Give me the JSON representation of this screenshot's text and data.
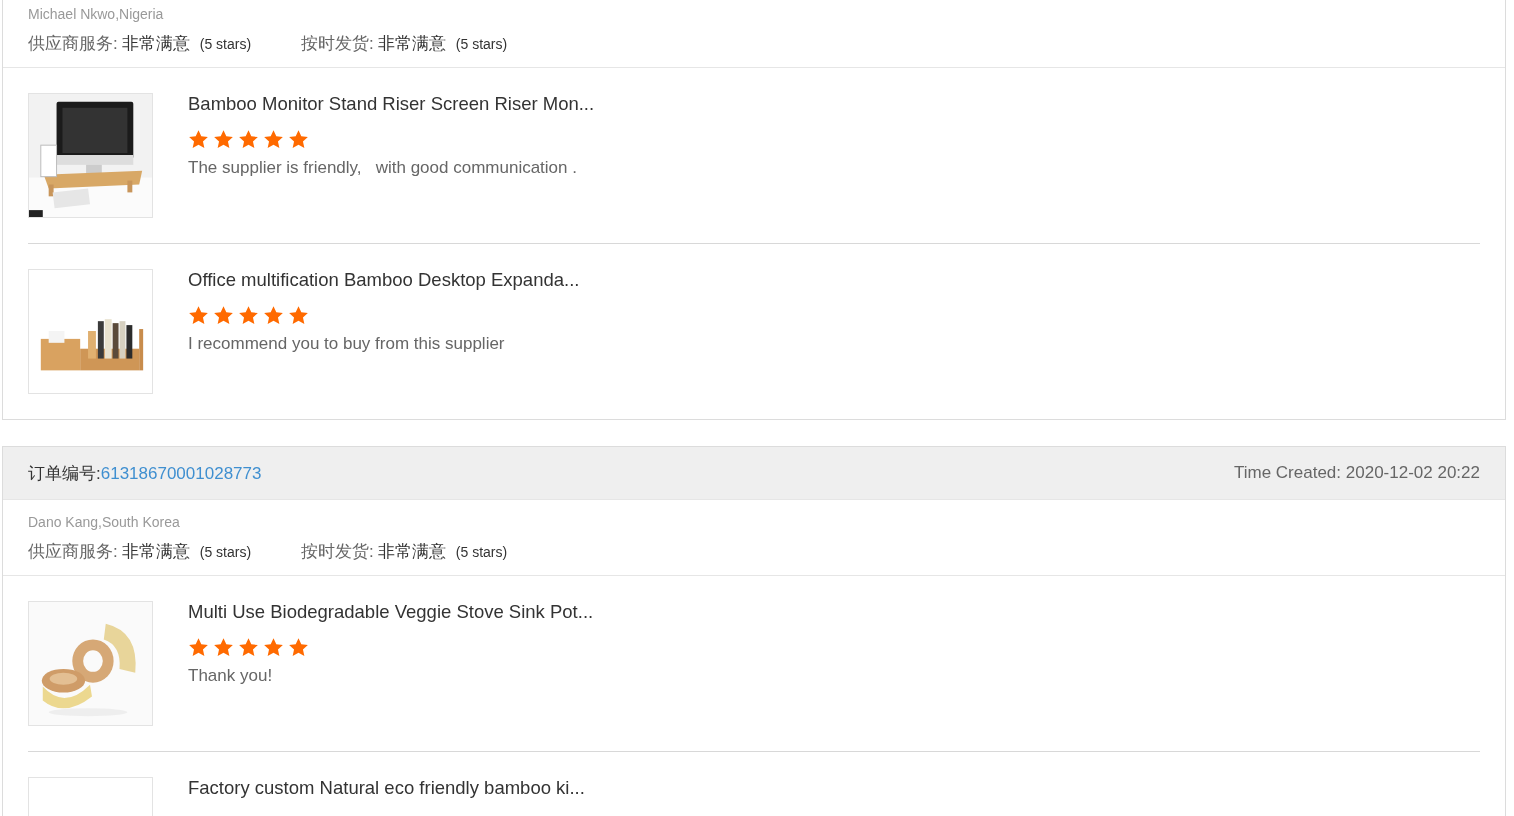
{
  "orders": [
    {
      "buyer": "Michael Nkwo,Nigeria",
      "ratings": [
        {
          "label": "供应商服务:",
          "value": "非常满意",
          "stars_text": "(5 stars)"
        },
        {
          "label": "按时发货:",
          "value": "非常满意",
          "stars_text": "(5 stars)"
        }
      ],
      "products": [
        {
          "title": "Bamboo Monitor Stand Riser Screen Riser Mon...",
          "stars": 5,
          "comment": "The supplier is friendly,   with good communication .",
          "kind": "picture"
        },
        {
          "title": "Office multification Bamboo Desktop Expanda...",
          "stars": 5,
          "comment": "I recommend you to buy from this supplier",
          "kind": "picture"
        }
      ]
    },
    {
      "order_label": "订单编号:",
      "order_number": "61318670001028773",
      "time_created": "Time Created: 2020-12-02 20:22",
      "buyer": "Dano Kang,South Korea",
      "ratings": [
        {
          "label": "供应商服务:",
          "value": "非常满意",
          "stars_text": "(5 stars)"
        },
        {
          "label": "按时发货:",
          "value": "非常满意",
          "stars_text": "(5 stars)"
        }
      ],
      "products": [
        {
          "title": "Multi Use Biodegradable Veggie Stove Sink Pot...",
          "stars": 5,
          "comment": "Thank you!",
          "kind": "picture"
        },
        {
          "title": "Factory custom Natural eco friendly bamboo ki..."
        }
      ]
    }
  ]
}
